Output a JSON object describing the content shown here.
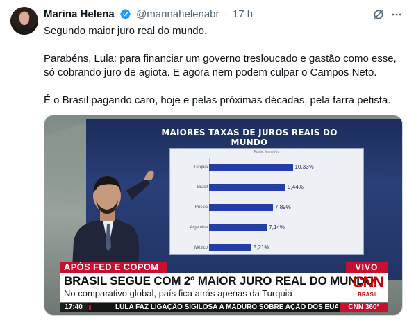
{
  "tweet": {
    "author_name": "Marina Helena",
    "handle": "@marinahelenabr",
    "separator": "·",
    "time": "17 h",
    "icons": [
      "verified-badge-icon",
      "grok-icon",
      "more-icon",
      "avatar"
    ],
    "lines": [
      "Segundo maior juro real do mundo.",
      "",
      "Parabéns, Lula: para financiar um governo tresloucado e gastão como esse,",
      "só cobrando juro de agiota. E agora nem podem culpar o Campos Neto.",
      "",
      "É o Brasil pagando caro, hoje e pelas próximas décadas, pela farra petista."
    ]
  },
  "media": {
    "screen": {
      "title": "MAIORES TAXAS DE JUROS REAIS DO MUNDO",
      "source": "Fonte: MoneYou"
    },
    "lower_third": {
      "tag": "APÓS FED E COPOM",
      "live": "VIVO",
      "headline": "BRASIL SEGUE COM 2º MAIOR JURO REAL DO MUNDO",
      "subheadline": "No comparativo global, país fica atrás apenas da Turquia",
      "logo_text": "CNN",
      "logo_sub": "BRASIL",
      "ticker_time": "17:40",
      "ticker_text": "LULA FAZ LIGAÇÃO SIGILOSA A MADURO SOBRE AÇÃO DOS EUA NO C",
      "ticker_brand": "CNN 360°"
    },
    "colors": {
      "cnn_red": "#c8102e",
      "bar_blue": "#233ea8"
    }
  },
  "chart_data": {
    "type": "bar",
    "orientation": "horizontal",
    "title": "MAIORES TAXAS DE JUROS REAIS DO MUNDO",
    "categories": [
      "Turquia",
      "Brasil",
      "Rússia",
      "Argentina",
      "México"
    ],
    "values": [
      10.33,
      9.44,
      7.89,
      7.14,
      5.21
    ],
    "value_labels": [
      "10,33%",
      "9,44%",
      "7,89%",
      "7,14%",
      "5,21%"
    ],
    "xlim": [
      0,
      12
    ]
  }
}
